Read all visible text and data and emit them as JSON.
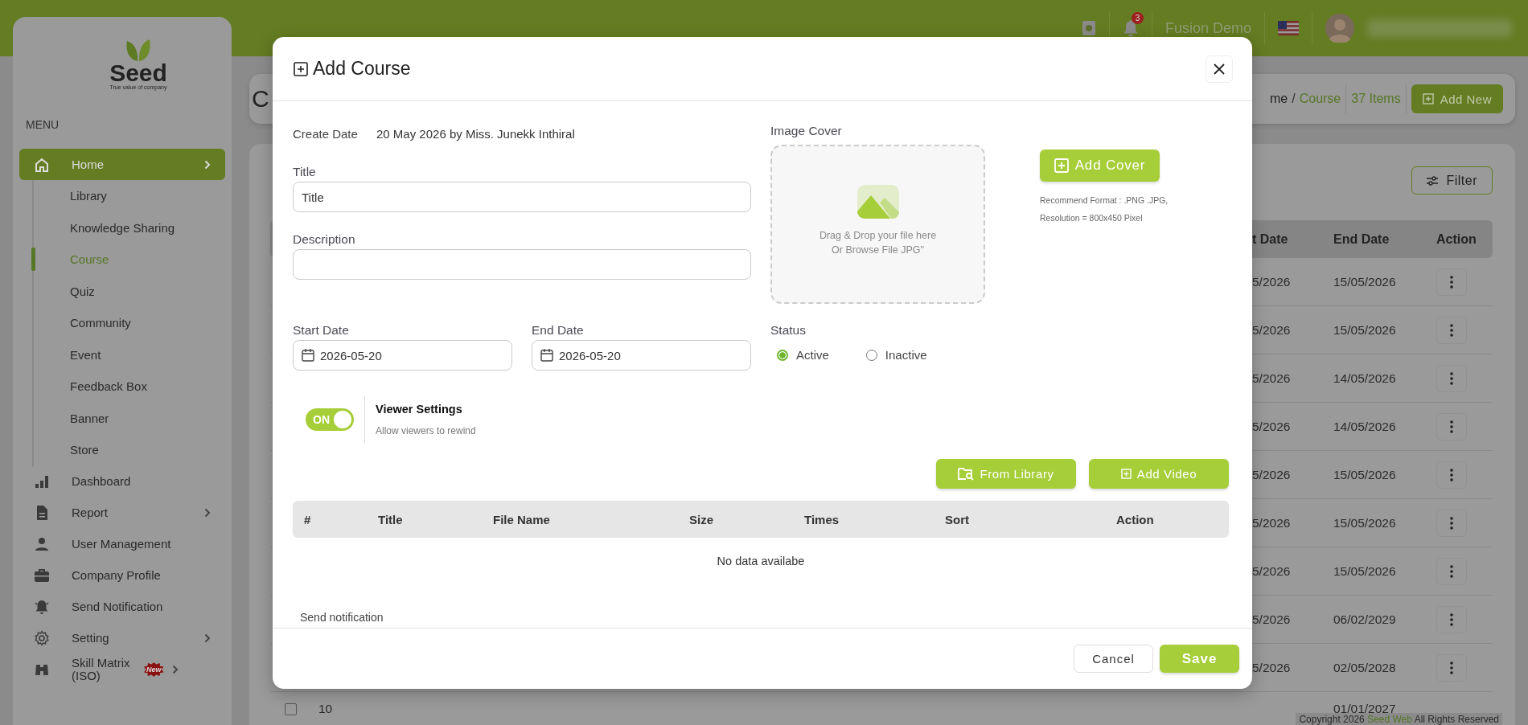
{
  "top_bar": {
    "notification_count": "3",
    "user_name": "Fusion Demo"
  },
  "sidebar": {
    "logo_text": "Seed",
    "tagline": "True value of company",
    "menu_label": "MENU",
    "items": [
      {
        "label": "Home",
        "selected": true,
        "has_submenu": true,
        "children": [
          {
            "label": "Library",
            "selected": false
          },
          {
            "label": "Knowledge Sharing",
            "selected": false
          },
          {
            "label": "Course",
            "selected": true
          },
          {
            "label": "Quiz",
            "selected": false
          },
          {
            "label": "Community",
            "selected": false
          },
          {
            "label": "Event",
            "selected": false
          },
          {
            "label": "Feedback Box",
            "selected": false
          },
          {
            "label": "Banner",
            "selected": false
          },
          {
            "label": "Store",
            "selected": false
          }
        ]
      },
      {
        "label": "Dashboard",
        "selected": false,
        "has_submenu": false
      },
      {
        "label": "Report",
        "selected": false,
        "has_submenu": true
      },
      {
        "label": "User Management",
        "selected": false,
        "has_submenu": false
      },
      {
        "label": "Company Profile",
        "selected": false,
        "has_submenu": false
      },
      {
        "label": "Send Notification",
        "selected": false,
        "has_submenu": false
      },
      {
        "label": "Setting",
        "selected": false,
        "has_submenu": true
      },
      {
        "label": "Skill Matrix (ISO)",
        "selected": false,
        "has_submenu": true,
        "badge": "New"
      }
    ]
  },
  "page_header": {
    "title": "C",
    "breadcrumb": [
      {
        "label": "me",
        "selected": false
      },
      {
        "label": "Course",
        "selected": true
      }
    ],
    "breadcrumb_separator": "/",
    "count": "37 Items",
    "add_button": "Add New"
  },
  "course_list": {
    "filter_button": "Filter",
    "columns": [
      "t Date",
      "End Date",
      "Action"
    ],
    "rows": [
      {
        "start": "5/2026",
        "end": "15/05/2026"
      },
      {
        "start": "5/2026",
        "end": "15/05/2026"
      },
      {
        "start": "5/2026",
        "end": "14/05/2026"
      },
      {
        "start": "5/2026",
        "end": "14/05/2026"
      },
      {
        "start": "5/2026",
        "end": "15/05/2026"
      },
      {
        "start": "5/2026",
        "end": "15/05/2026"
      },
      {
        "start": "5/2026",
        "end": "15/05/2026"
      },
      {
        "start": "5/2026",
        "end": "06/02/2029"
      },
      {
        "start": "5/2026",
        "end": "02/05/2028"
      }
    ],
    "last_row": {
      "checked": false,
      "number": "10",
      "end": "01/01/2027"
    }
  },
  "footer": {
    "prefix": "Copyright 2026",
    "brand": "Seed Web",
    "suffix": "All Rights Reserved"
  },
  "modal": {
    "title": "Add Course",
    "create_date_label": "Create Date",
    "create_date_value": "20 May 2026 by Miss. Junekk Inthiral",
    "title_field": {
      "label": "Title",
      "value": "Title"
    },
    "description_field": {
      "label": "Description"
    },
    "start_date": {
      "label": "Start Date",
      "value": "2026-05-20"
    },
    "end_date": {
      "label": "End Date",
      "value": "2026-05-20"
    },
    "image_cover": {
      "label": "Image Cover",
      "drop_text": [
        "Drag & Drop your file here",
        "Or Browse File JPG\""
      ],
      "button": "Add Cover",
      "hints": [
        "Recommend Format : .PNG .JPG,",
        "Resolution = 800x450 Pixel"
      ]
    },
    "status": {
      "label": "Status",
      "options": [
        {
          "label": "Active",
          "selected": true
        },
        {
          "label": "Inactive",
          "selected": false
        }
      ]
    },
    "viewer_settings": {
      "toggle_text": "ON",
      "on": true,
      "title": "Viewer Settings",
      "description": "Allow viewers to rewind"
    },
    "video_buttons": [
      "From Library",
      "Add Video"
    ],
    "video_table": {
      "columns": [
        "#",
        "Title",
        "File Name",
        "Size",
        "Times",
        "Sort",
        "Action"
      ],
      "empty_text": "No data availabe"
    },
    "send_notification_label": "Send notification",
    "cancel_button": "Cancel",
    "save_button": "Save"
  }
}
